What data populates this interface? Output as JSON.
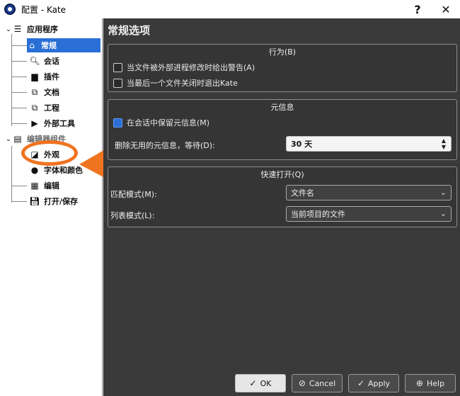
{
  "window": {
    "title": "配置 - Kate",
    "help_glyph": "?",
    "close_glyph": "✕"
  },
  "sidebar": {
    "groups": [
      {
        "label": "应用程序",
        "icon": "menu-lines-icon",
        "items": [
          {
            "label": "常规",
            "icon": "home-icon",
            "selected": true
          },
          {
            "label": "会话",
            "icon": "magnifier-icon"
          },
          {
            "label": "插件",
            "icon": "plugin-icon"
          },
          {
            "label": "文档",
            "icon": "documents-icon"
          },
          {
            "label": "工程",
            "icon": "project-icon"
          },
          {
            "label": "外部工具",
            "icon": "external-tools-icon"
          }
        ]
      },
      {
        "label": "编辑器组件",
        "icon": "editor-component-icon",
        "items": [
          {
            "label": "外观",
            "icon": "appearance-icon"
          },
          {
            "label": "字体和颜色",
            "icon": "color-palette-icon"
          },
          {
            "label": "编辑",
            "icon": "edit-icon"
          },
          {
            "label": "打开/保存",
            "icon": "save-icon"
          }
        ]
      }
    ]
  },
  "main": {
    "title": "常规选项",
    "behavior": {
      "heading": "行为(B)",
      "warn_external_change": {
        "label": "当文件被外部进程修改时给出警告(A)",
        "checked": false
      },
      "quit_on_last_close": {
        "label": "当最后一个文件关闭时退出Kate",
        "checked": false
      }
    },
    "meta": {
      "heading": "元信息",
      "keep_meta": {
        "label": "在会话中保留元信息(M)",
        "checked": true
      },
      "delete_unused_label": "删除无用的元信息，等待(D):",
      "delete_unused_value": "30 天"
    },
    "quick_open": {
      "heading": "快速打开(Q)",
      "match_mode_label": "匹配模式(M):",
      "match_mode_value": "文件名",
      "list_mode_label": "列表模式(L):",
      "list_mode_value": "当前项目的文件"
    }
  },
  "buttons": {
    "ok": "OK",
    "cancel": "Cancel",
    "apply": "Apply",
    "help": "Help"
  },
  "annotation_color": "#f07320",
  "selection_color": "#2a6fd6"
}
